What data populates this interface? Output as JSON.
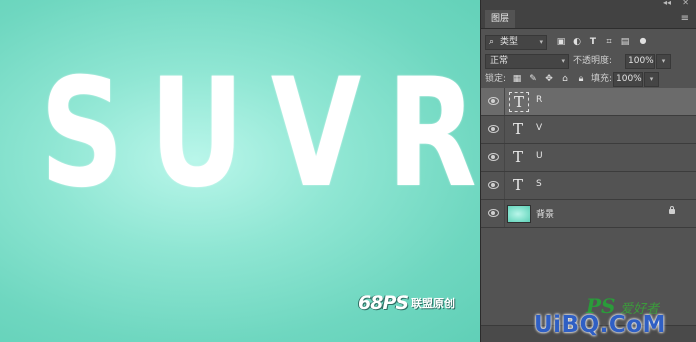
{
  "canvas": {
    "letters": [
      "S",
      "U",
      "V",
      "R"
    ],
    "watermark_mark": "68PS",
    "watermark_text": "联盟原创"
  },
  "panel": {
    "tab_label": "图层",
    "filter_kind": "类型",
    "blend_mode": "正常",
    "opacity_label": "不透明度:",
    "opacity_value": "100%",
    "lock_label": "锁定:",
    "fill_label": "填充:",
    "fill_value": "100%",
    "layers": [
      {
        "name": "R",
        "type": "text",
        "selected": true
      },
      {
        "name": "V",
        "type": "text",
        "selected": false
      },
      {
        "name": "U",
        "type": "text",
        "selected": false
      },
      {
        "name": "S",
        "type": "text",
        "selected": false
      },
      {
        "name": "背景",
        "type": "image",
        "locked": true
      }
    ]
  },
  "site_watermark": {
    "ps": "PS",
    "cn": "爱好者",
    "url": "UiBQ.CoM"
  },
  "colors": {
    "canvas_bg": "#7fe0cb",
    "panel_bg": "#535353",
    "selected_layer": "#6b6b6b",
    "url_blue": "#2f5fc4",
    "ps_green": "#2a9b3a"
  },
  "icons": {
    "panel_collapse": "double-chevron-icon",
    "panel_close": "close-icon",
    "panel_menu": "menu-icon",
    "filter": "search-icon",
    "layer_visibility": "eye-icon",
    "layer_lock": "lock-icon"
  }
}
